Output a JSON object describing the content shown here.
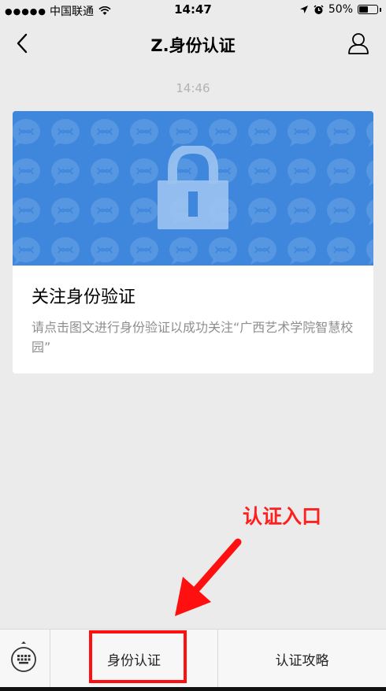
{
  "status_bar": {
    "signal": "●●●●●",
    "carrier": "中国联通",
    "time": "14:47",
    "battery_percent": "50%",
    "battery_level": 0.5
  },
  "nav": {
    "title": "Z.身份认证"
  },
  "chat": {
    "timestamp": "14:46"
  },
  "card": {
    "title": "关注身份验证",
    "description": "请点击图文进行身份验证以成功关注“广西艺术学院智慧校园”",
    "cover_color": "#3f87dd"
  },
  "annotation": {
    "text": "认证入口",
    "color": "#ff1f1f"
  },
  "menu": {
    "items": [
      {
        "label": "身份认证"
      },
      {
        "label": "认证攻略"
      }
    ]
  }
}
